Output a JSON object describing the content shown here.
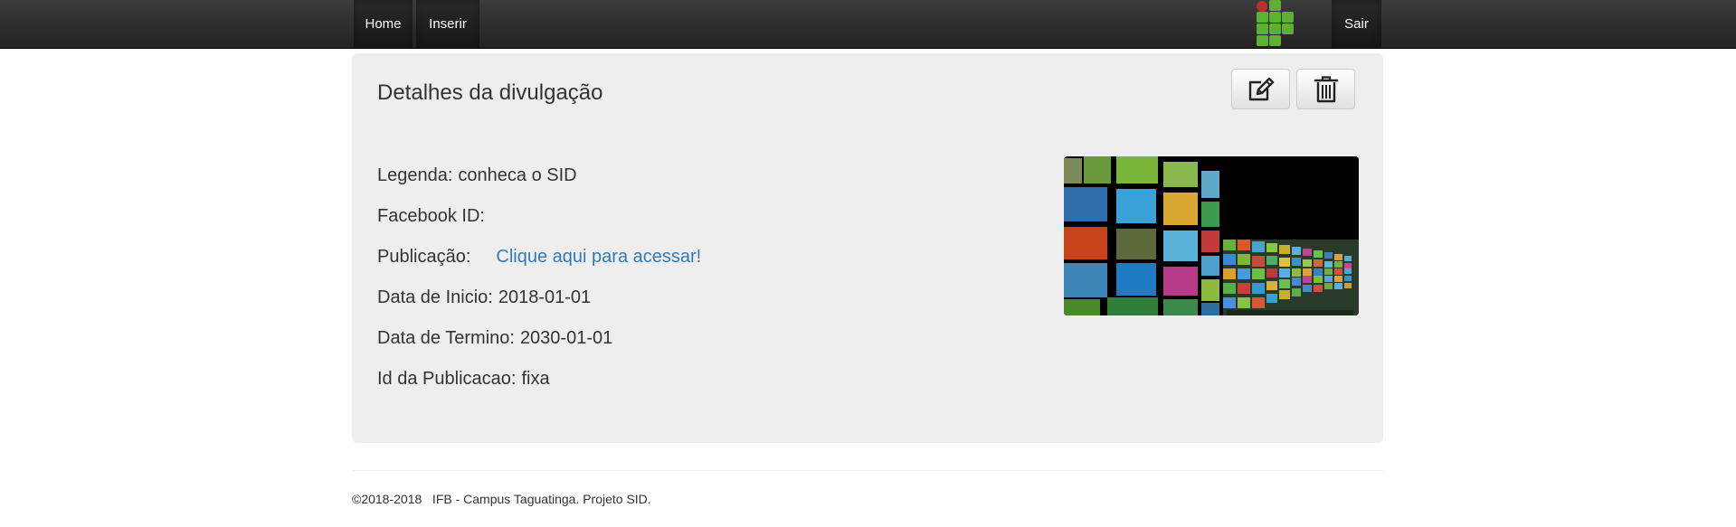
{
  "navbar": {
    "home_label": "Home",
    "insert_label": "Inserir",
    "exit_label": "Sair",
    "logo_colors": {
      "green": "#5cb135",
      "red": "#b8322d"
    }
  },
  "panel": {
    "title": "Detalhes da divulgação",
    "actions": {
      "edit_icon": "edit-icon",
      "delete_icon": "trash-icon"
    },
    "fields": {
      "legenda_label": "Legenda:",
      "legenda_value": "conheca o SID",
      "facebook_label": "Facebook ID:",
      "facebook_value": "",
      "publicacao_label": "Publicação:",
      "publicacao_link": "Clique aqui para acessar!",
      "inicio_label": "Data de Inicio:",
      "inicio_value": "2018-01-01",
      "termino_label": "Data de Termino:",
      "termino_value": "2030-01-01",
      "id_label": "Id da Publicacao:",
      "id_value": "fixa"
    },
    "media": {
      "alt": "wall of screens image",
      "link_color": "#337ab7"
    }
  },
  "footer": {
    "text": "©2018-2018   IFB - Campus Taguatinga. Projeto SID."
  }
}
